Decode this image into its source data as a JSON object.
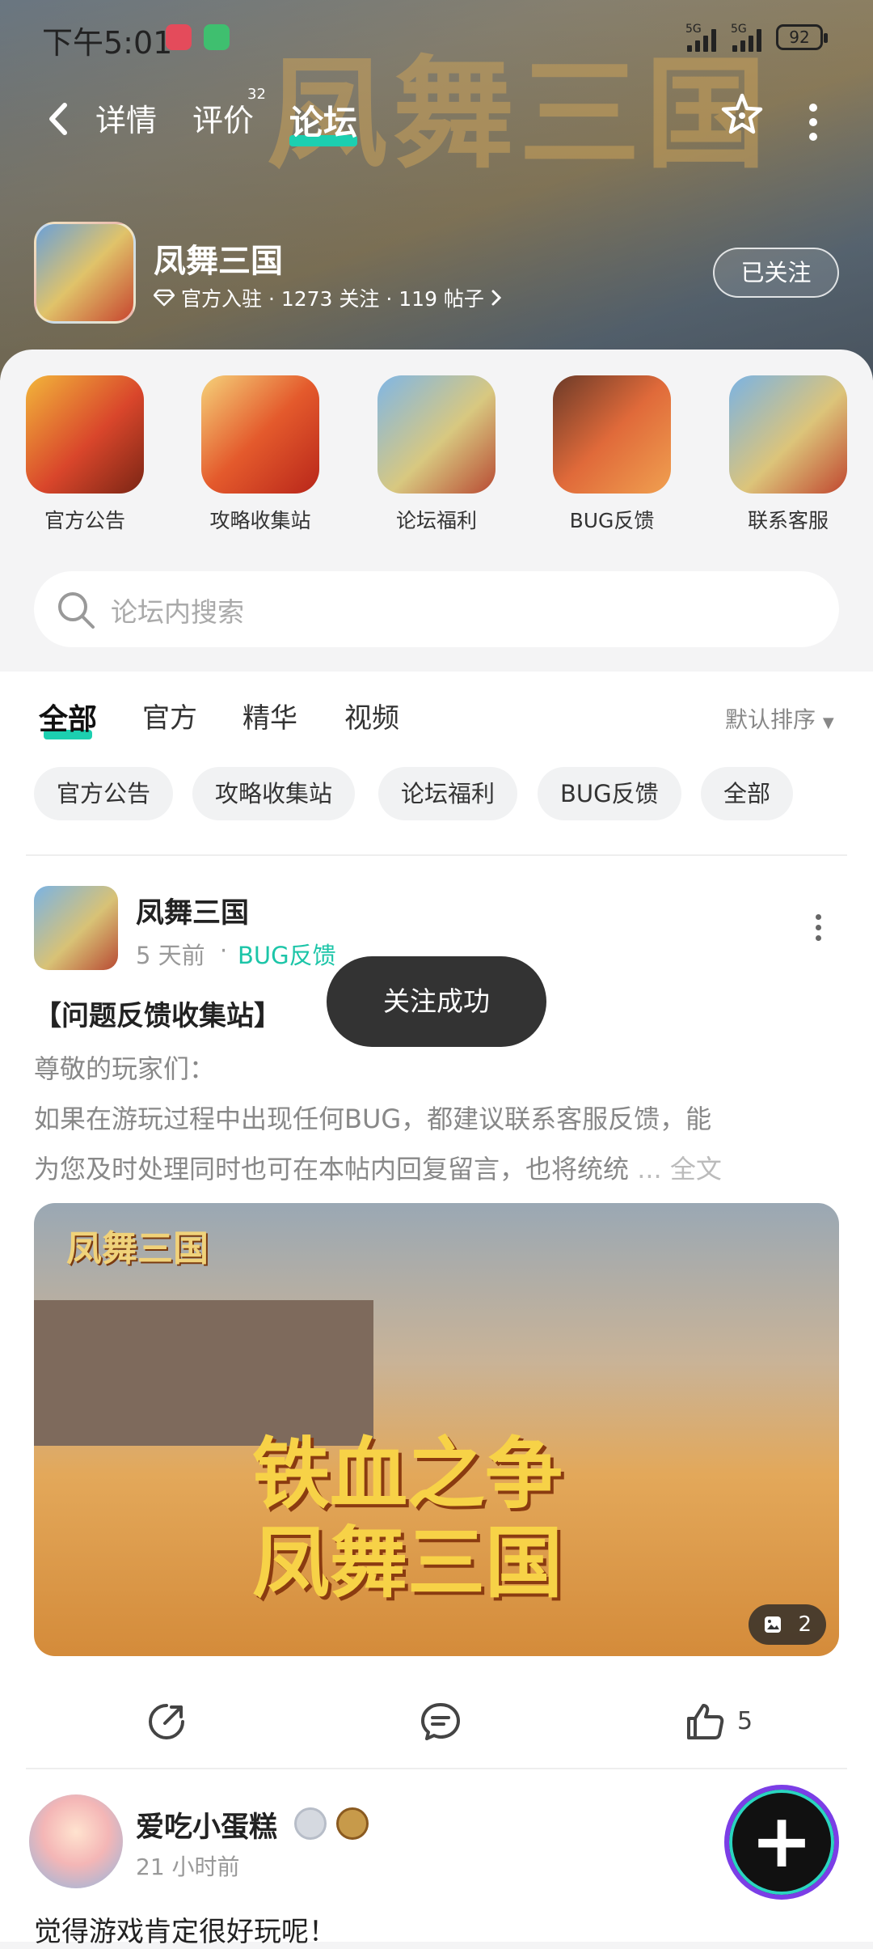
{
  "status_bar": {
    "time": "下午5:01",
    "signal1": "5G",
    "signal2": "5G",
    "battery": "92"
  },
  "nav": {
    "tabs": [
      {
        "label": "详情"
      },
      {
        "label": "评价"
      },
      {
        "label": "论坛"
      }
    ],
    "review_badge": "32",
    "active_tab": "论坛"
  },
  "header_bg_title": "凤舞三国",
  "game": {
    "name": "凤舞三国",
    "meta": "官方入驻 · 1273 关注 · 119 帖子",
    "follow_label": "已关注"
  },
  "categories": [
    {
      "label": "官方公告"
    },
    {
      "label": "攻略收集站"
    },
    {
      "label": "论坛福利"
    },
    {
      "label": "BUG反馈"
    },
    {
      "label": "联系客服"
    }
  ],
  "search": {
    "placeholder": "论坛内搜索"
  },
  "filter_tabs": [
    {
      "label": "全部"
    },
    {
      "label": "官方"
    },
    {
      "label": "精华"
    },
    {
      "label": "视频"
    }
  ],
  "sort_label": "默认排序",
  "chips": [
    {
      "label": "官方公告"
    },
    {
      "label": "攻略收集站"
    },
    {
      "label": "论坛福利"
    },
    {
      "label": "BUG反馈"
    },
    {
      "label": "全部"
    }
  ],
  "post1": {
    "author": "凤舞三国",
    "time": "5 天前",
    "category": "BUG反馈",
    "title": "【问题反馈收集站】",
    "line1": "尊敬的玩家们：",
    "line2": " 如果在游玩过程中出现任何BUG，都建议联系客服反馈，能",
    "line3": "为您及时处理同时也可在本帖内回复留言，也将统统",
    "read_more": " ... 全文",
    "image_logo": "凤舞三国",
    "image_title_1": "铁血之争",
    "image_title_2": "凤舞三国",
    "image_count": "2",
    "likes": "5"
  },
  "toast": "关注成功",
  "post2": {
    "author": "爱吃小蛋糕",
    "time": "21 小时前",
    "text": "觉得游戏肯定很好玩呢！"
  },
  "colors": {
    "accent": "#1ccfb0",
    "category_text": "#1cc5a8"
  }
}
